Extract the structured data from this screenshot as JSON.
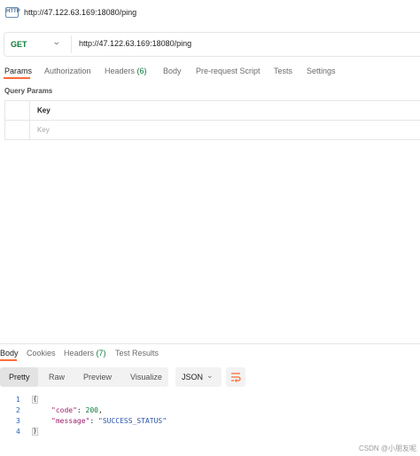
{
  "window": {
    "title": "http://47.122.63.169:18080/ping",
    "icon": "http-icon",
    "icon_text": "HTTP"
  },
  "request": {
    "method": "GET",
    "url": "http://47.122.63.169:18080/ping",
    "tabs": [
      {
        "label": "Params",
        "active": true
      },
      {
        "label": "Authorization"
      },
      {
        "label": "Headers",
        "count": "(6)"
      },
      {
        "label": "Body"
      },
      {
        "label": "Pre-request Script"
      },
      {
        "label": "Tests"
      },
      {
        "label": "Settings"
      }
    ],
    "query_params_title": "Query Params",
    "table": {
      "header_key": "Key",
      "placeholder_key": "Key"
    }
  },
  "response": {
    "tabs": [
      {
        "label": "Body",
        "active": true
      },
      {
        "label": "Cookies"
      },
      {
        "label": "Headers",
        "count": "(7)"
      },
      {
        "label": "Test Results"
      }
    ],
    "view_modes": [
      "Pretty",
      "Raw",
      "Preview",
      "Visualize"
    ],
    "active_view": "Pretty",
    "format": "JSON",
    "code": {
      "line_numbers": [
        "1",
        "2",
        "3",
        "4"
      ],
      "open_brace": "{",
      "close_brace": "}",
      "code_key": "\"code\"",
      "code_value": "200",
      "message_key": "\"message\"",
      "message_value": "\"SUCCESS_STATUS\""
    }
  },
  "watermark": "CSDN @小朋友呢",
  "colors": {
    "accent": "#ff6c37",
    "method": "#0b7a3a",
    "count": "#0b7a3a"
  }
}
